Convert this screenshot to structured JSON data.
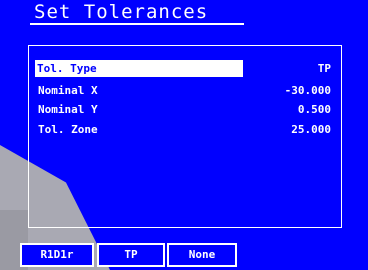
{
  "title": "Set Tolerances",
  "rows": [
    {
      "label": "Tol. Type",
      "value": "TP"
    },
    {
      "label": "Nominal X",
      "value": "-30.000"
    },
    {
      "label": "Nominal Y",
      "value": "0.500"
    },
    {
      "label": "Tol. Zone",
      "value": "25.000"
    }
  ],
  "softkeys": [
    "R1D1r",
    "TP",
    "None"
  ],
  "colors": {
    "background": "#0000ff",
    "text": "#ffffff",
    "selection_text": "#0000ff"
  }
}
